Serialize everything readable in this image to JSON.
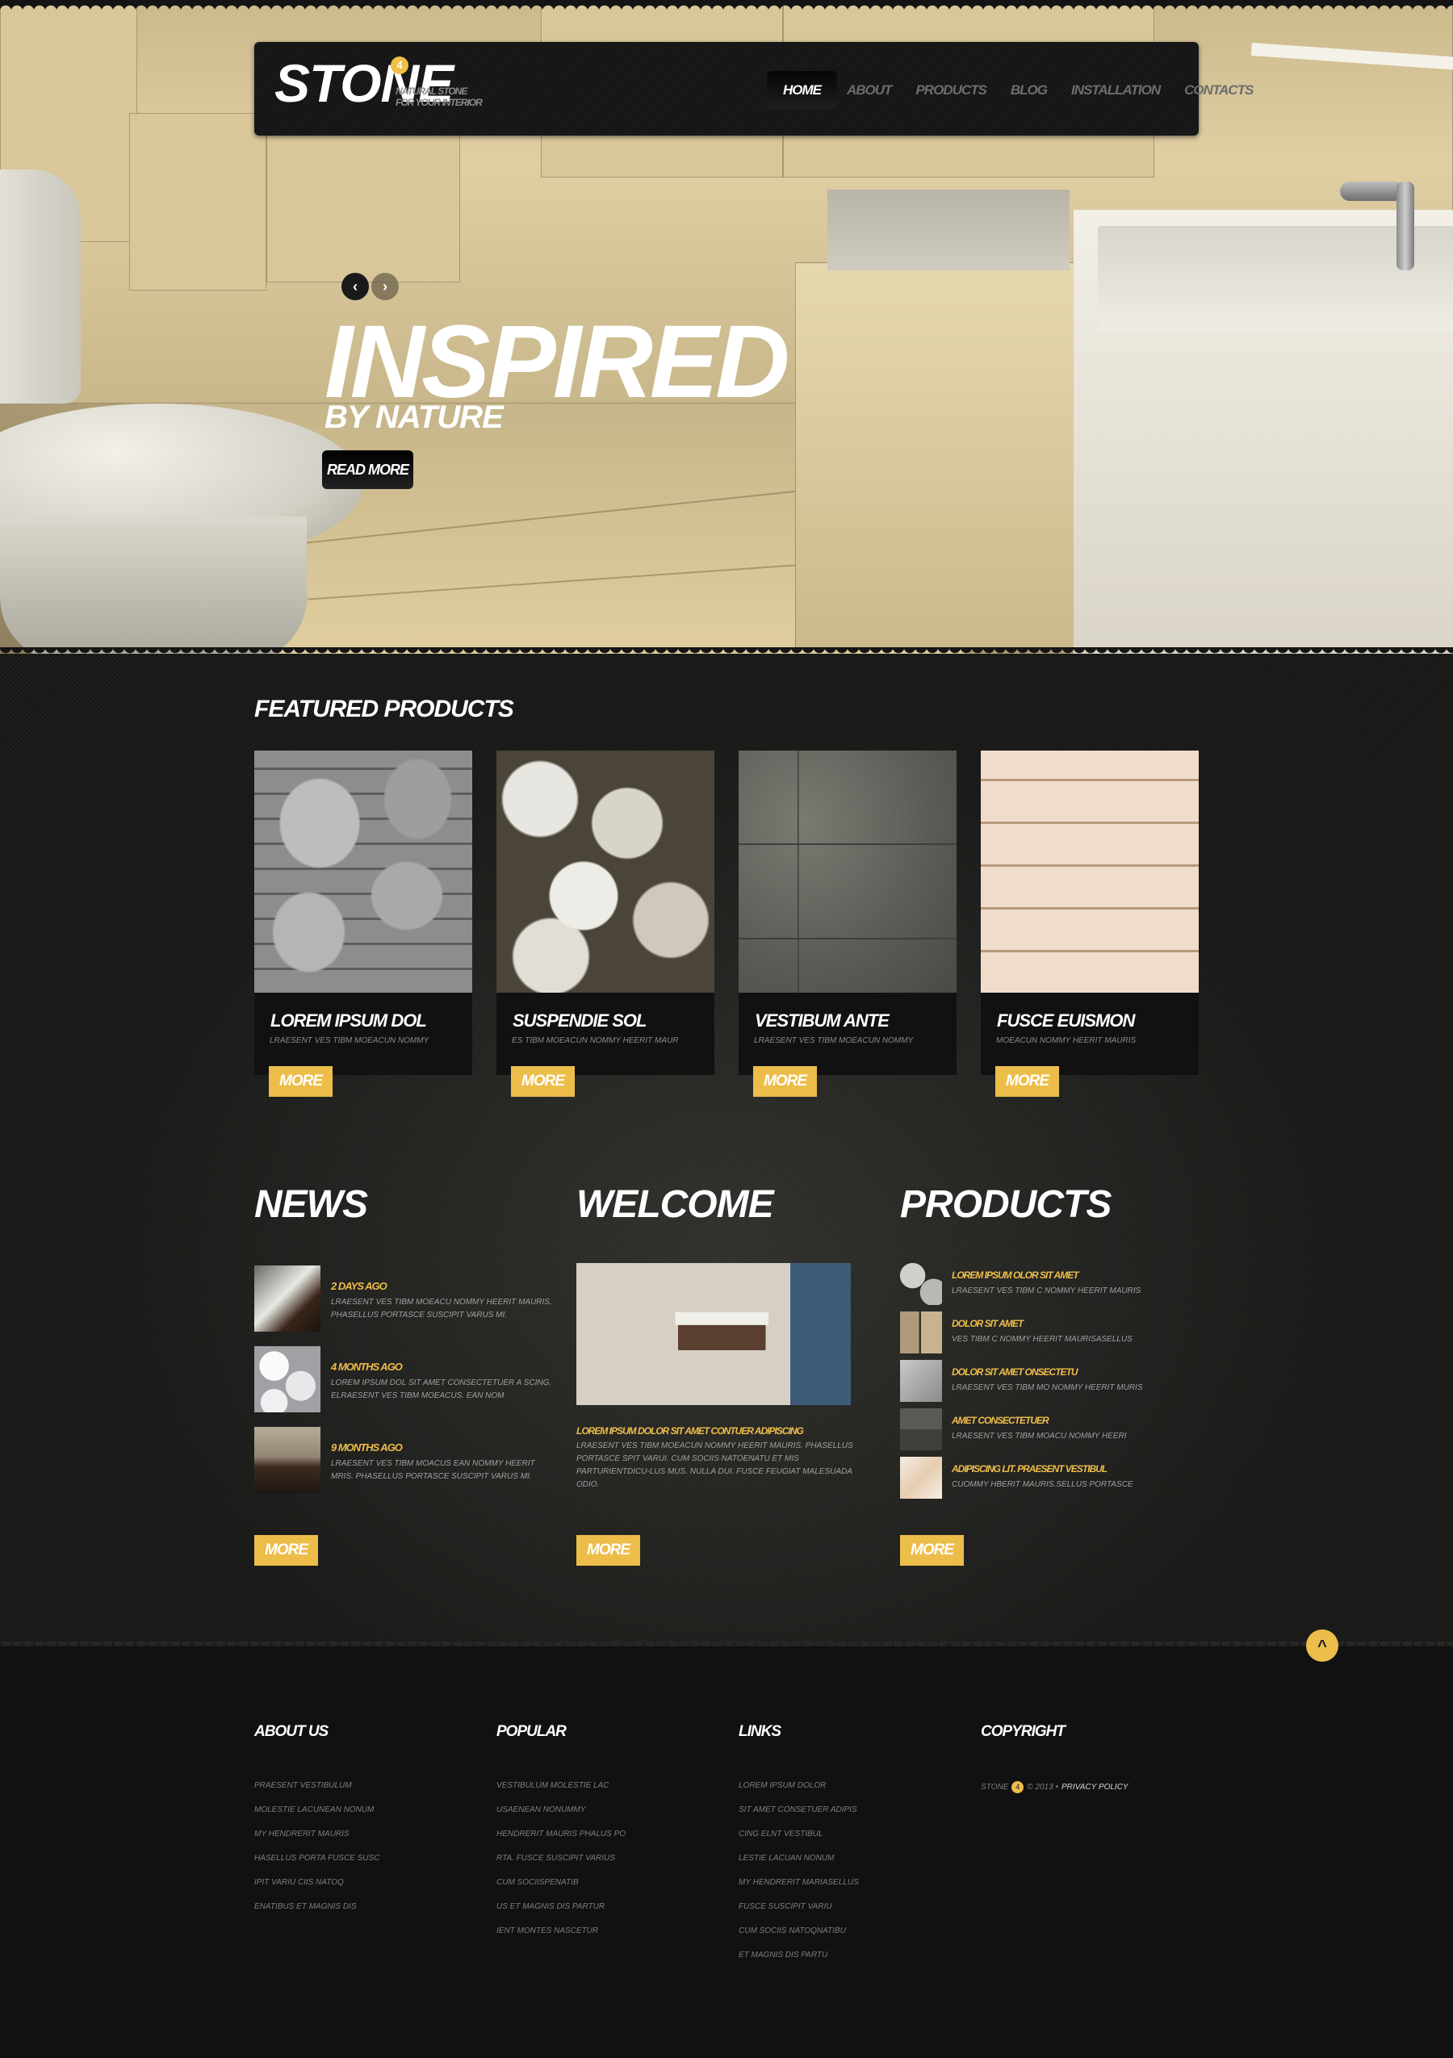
{
  "brand": {
    "name": "STONE",
    "badge": "4",
    "tagline_line1": "NATURAL STONE",
    "tagline_line2": "FOR YOUR INTERIOR"
  },
  "nav": {
    "items": [
      {
        "label": "HOME",
        "active": true
      },
      {
        "label": "ABOUT",
        "active": false
      },
      {
        "label": "PRODUCTS",
        "active": false
      },
      {
        "label": "BLOG",
        "active": false
      },
      {
        "label": "INSTALLATION",
        "active": false
      },
      {
        "label": "CONTACTS",
        "active": false
      }
    ]
  },
  "hero": {
    "prev_icon": "‹",
    "next_icon": "›",
    "title": "INSPIRED",
    "subtitle": "BY NATURE",
    "button_label": "READ MORE"
  },
  "featured": {
    "title": "FEATURED PRODUCTS",
    "products": [
      {
        "title": "LOREM IPSUM DOL",
        "desc": "LRAESENT VES TIBM MOEACUN NOMMY",
        "button": "MORE"
      },
      {
        "title": "SUSPENDIE SOL",
        "desc": "ES TIBM MOEACUN NOMMY HEERIT MAUR",
        "button": "MORE"
      },
      {
        "title": "VESTIBUM ANTE",
        "desc": "LRAESENT VES TIBM MOEACUN NOMMY",
        "button": "MORE"
      },
      {
        "title": "FUSCE EUISMON",
        "desc": "MOEACUN NOMMY HEERIT MAURIS",
        "button": "MORE"
      }
    ]
  },
  "news": {
    "title": "NEWS",
    "items": [
      {
        "date": "2 DAYS AGO",
        "text": "LRAESENT VES TIBM MOEACU NOMMY HEERIT MAURIS. PHASELLUS PORTASCE SUSCIPIT VARUS MI."
      },
      {
        "date": "4 MONTHS AGO",
        "text": "LOREM IPSUM DOL SIT AMET CONSECTETUER A SCING. ELRAESENT VES TIBM MOEACUS. EAN NOM"
      },
      {
        "date": "9 MONTHS AGO",
        "text": "LRAESENT VES TIBM MOACUS EAN NOMMY HEERIT MRIS. PHASELLUS PORTASCE SUSCIPIT VARUS MI."
      }
    ],
    "button": "MORE"
  },
  "welcome": {
    "title": "WELCOME",
    "headline": "LOREM IPSUM DOLOR SIT AMET CONTUER ADIPISCING",
    "text": "LRAESENT VES TIBM MOEACUN NOMMY HEERIT MAURIS. PHASELLUS PORTASCE SPIT VARUI. CUM SOCIIS NATOENATU ET MIS PARTURIENTDICU-LUS MUS. NULLA DUI. FUSCE FEUGIAT MALESUADA ODIO.",
    "button": "MORE"
  },
  "products": {
    "title": "PRODUCTS",
    "items": [
      {
        "title": "LOREM IPSUM OLOR SIT AMET",
        "desc": "LRAESENT VES TIBM C NOMMY HEERIT MAURIS"
      },
      {
        "title": "DOLOR SIT AMET",
        "desc": "VES TIBM C NOMMY HEERIT MAURISASELLUS"
      },
      {
        "title": "DOLOR SIT AMET ONSECTETU",
        "desc": "LRAESENT VES TIBM MO NOMMY HEERIT MURIS"
      },
      {
        "title": "AMET CONSECTETUER",
        "desc": "LRAESENT VES TIBM MOACU NOMMY HEERI"
      },
      {
        "title": "ADIPISCING LIT. PRAESENT VESTIBUL",
        "desc": "CUOMMY HBERIT MAURIS.SELLUS PORTASCE"
      }
    ],
    "button": "MORE"
  },
  "back_to_top_icon": "^",
  "footer": {
    "about": {
      "title": "ABOUT US",
      "links": [
        "PRAESENT VESTIBULUM",
        "MOLESTIE LACUNEAN NONUM",
        "MY HENDRERIT MAURIS",
        "HASELLUS PORTA FUSCE SUSC",
        "IPIT VARIU CIIS NATOQ",
        "ENATIBUS ET MAGNIS DIS"
      ]
    },
    "popular": {
      "title": "POPULAR",
      "links": [
        "VESTIBULUM MOLESTIE LAC",
        "USAENEAN NONUMMY",
        "HENDRERIT MAURIS PHALUS PO",
        "RTA. FUSCE SUSCIPIT VARIUS",
        "CUM SOCIISPENATIB",
        "US ET MAGNIS DIS PARTUR",
        "IENT MONTES NASCETUR"
      ]
    },
    "links": {
      "title": "LINKS",
      "links": [
        "LOREM IPSUM DOLOR",
        "SIT AMET CONSETUER ADIPIS",
        "CING ELNT VESTIBUL",
        "LESTIE LACUAN NONUM",
        "MY HENDRERIT MARIASELLUS",
        "FUSCE SUSCIPIT VARIU",
        "CUM SOCIIS NATOQNATIBU",
        "ET MAGNIS DIS PARTU"
      ]
    },
    "copyright": {
      "title": "COPYRIGHT",
      "brand": "STONE",
      "badge": "4",
      "text": "© 2013 •",
      "privacy": "PRIVACY POLICY"
    }
  },
  "colors": {
    "accent": "#edbd4a",
    "dark_bg": "#111111",
    "text_muted": "#a0a0a0"
  }
}
